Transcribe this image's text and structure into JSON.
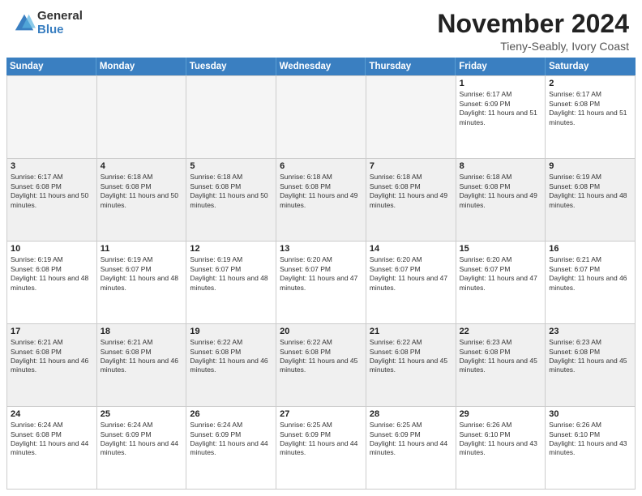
{
  "logo": {
    "general": "General",
    "blue": "Blue"
  },
  "header": {
    "month": "November 2024",
    "location": "Tieny-Seably, Ivory Coast"
  },
  "weekdays": [
    "Sunday",
    "Monday",
    "Tuesday",
    "Wednesday",
    "Thursday",
    "Friday",
    "Saturday"
  ],
  "weeks": [
    [
      {
        "day": "",
        "empty": true
      },
      {
        "day": "",
        "empty": true
      },
      {
        "day": "",
        "empty": true
      },
      {
        "day": "",
        "empty": true
      },
      {
        "day": "",
        "empty": true
      },
      {
        "day": "1",
        "sunrise": "Sunrise: 6:17 AM",
        "sunset": "Sunset: 6:09 PM",
        "daylight": "Daylight: 11 hours and 51 minutes."
      },
      {
        "day": "2",
        "sunrise": "Sunrise: 6:17 AM",
        "sunset": "Sunset: 6:08 PM",
        "daylight": "Daylight: 11 hours and 51 minutes."
      }
    ],
    [
      {
        "day": "3",
        "sunrise": "Sunrise: 6:17 AM",
        "sunset": "Sunset: 6:08 PM",
        "daylight": "Daylight: 11 hours and 50 minutes."
      },
      {
        "day": "4",
        "sunrise": "Sunrise: 6:18 AM",
        "sunset": "Sunset: 6:08 PM",
        "daylight": "Daylight: 11 hours and 50 minutes."
      },
      {
        "day": "5",
        "sunrise": "Sunrise: 6:18 AM",
        "sunset": "Sunset: 6:08 PM",
        "daylight": "Daylight: 11 hours and 50 minutes."
      },
      {
        "day": "6",
        "sunrise": "Sunrise: 6:18 AM",
        "sunset": "Sunset: 6:08 PM",
        "daylight": "Daylight: 11 hours and 49 minutes."
      },
      {
        "day": "7",
        "sunrise": "Sunrise: 6:18 AM",
        "sunset": "Sunset: 6:08 PM",
        "daylight": "Daylight: 11 hours and 49 minutes."
      },
      {
        "day": "8",
        "sunrise": "Sunrise: 6:18 AM",
        "sunset": "Sunset: 6:08 PM",
        "daylight": "Daylight: 11 hours and 49 minutes."
      },
      {
        "day": "9",
        "sunrise": "Sunrise: 6:19 AM",
        "sunset": "Sunset: 6:08 PM",
        "daylight": "Daylight: 11 hours and 48 minutes."
      }
    ],
    [
      {
        "day": "10",
        "sunrise": "Sunrise: 6:19 AM",
        "sunset": "Sunset: 6:08 PM",
        "daylight": "Daylight: 11 hours and 48 minutes."
      },
      {
        "day": "11",
        "sunrise": "Sunrise: 6:19 AM",
        "sunset": "Sunset: 6:07 PM",
        "daylight": "Daylight: 11 hours and 48 minutes."
      },
      {
        "day": "12",
        "sunrise": "Sunrise: 6:19 AM",
        "sunset": "Sunset: 6:07 PM",
        "daylight": "Daylight: 11 hours and 48 minutes."
      },
      {
        "day": "13",
        "sunrise": "Sunrise: 6:20 AM",
        "sunset": "Sunset: 6:07 PM",
        "daylight": "Daylight: 11 hours and 47 minutes."
      },
      {
        "day": "14",
        "sunrise": "Sunrise: 6:20 AM",
        "sunset": "Sunset: 6:07 PM",
        "daylight": "Daylight: 11 hours and 47 minutes."
      },
      {
        "day": "15",
        "sunrise": "Sunrise: 6:20 AM",
        "sunset": "Sunset: 6:07 PM",
        "daylight": "Daylight: 11 hours and 47 minutes."
      },
      {
        "day": "16",
        "sunrise": "Sunrise: 6:21 AM",
        "sunset": "Sunset: 6:07 PM",
        "daylight": "Daylight: 11 hours and 46 minutes."
      }
    ],
    [
      {
        "day": "17",
        "sunrise": "Sunrise: 6:21 AM",
        "sunset": "Sunset: 6:08 PM",
        "daylight": "Daylight: 11 hours and 46 minutes."
      },
      {
        "day": "18",
        "sunrise": "Sunrise: 6:21 AM",
        "sunset": "Sunset: 6:08 PM",
        "daylight": "Daylight: 11 hours and 46 minutes."
      },
      {
        "day": "19",
        "sunrise": "Sunrise: 6:22 AM",
        "sunset": "Sunset: 6:08 PM",
        "daylight": "Daylight: 11 hours and 46 minutes."
      },
      {
        "day": "20",
        "sunrise": "Sunrise: 6:22 AM",
        "sunset": "Sunset: 6:08 PM",
        "daylight": "Daylight: 11 hours and 45 minutes."
      },
      {
        "day": "21",
        "sunrise": "Sunrise: 6:22 AM",
        "sunset": "Sunset: 6:08 PM",
        "daylight": "Daylight: 11 hours and 45 minutes."
      },
      {
        "day": "22",
        "sunrise": "Sunrise: 6:23 AM",
        "sunset": "Sunset: 6:08 PM",
        "daylight": "Daylight: 11 hours and 45 minutes."
      },
      {
        "day": "23",
        "sunrise": "Sunrise: 6:23 AM",
        "sunset": "Sunset: 6:08 PM",
        "daylight": "Daylight: 11 hours and 45 minutes."
      }
    ],
    [
      {
        "day": "24",
        "sunrise": "Sunrise: 6:24 AM",
        "sunset": "Sunset: 6:08 PM",
        "daylight": "Daylight: 11 hours and 44 minutes."
      },
      {
        "day": "25",
        "sunrise": "Sunrise: 6:24 AM",
        "sunset": "Sunset: 6:09 PM",
        "daylight": "Daylight: 11 hours and 44 minutes."
      },
      {
        "day": "26",
        "sunrise": "Sunrise: 6:24 AM",
        "sunset": "Sunset: 6:09 PM",
        "daylight": "Daylight: 11 hours and 44 minutes."
      },
      {
        "day": "27",
        "sunrise": "Sunrise: 6:25 AM",
        "sunset": "Sunset: 6:09 PM",
        "daylight": "Daylight: 11 hours and 44 minutes."
      },
      {
        "day": "28",
        "sunrise": "Sunrise: 6:25 AM",
        "sunset": "Sunset: 6:09 PM",
        "daylight": "Daylight: 11 hours and 44 minutes."
      },
      {
        "day": "29",
        "sunrise": "Sunrise: 6:26 AM",
        "sunset": "Sunset: 6:10 PM",
        "daylight": "Daylight: 11 hours and 43 minutes."
      },
      {
        "day": "30",
        "sunrise": "Sunrise: 6:26 AM",
        "sunset": "Sunset: 6:10 PM",
        "daylight": "Daylight: 11 hours and 43 minutes."
      }
    ]
  ]
}
